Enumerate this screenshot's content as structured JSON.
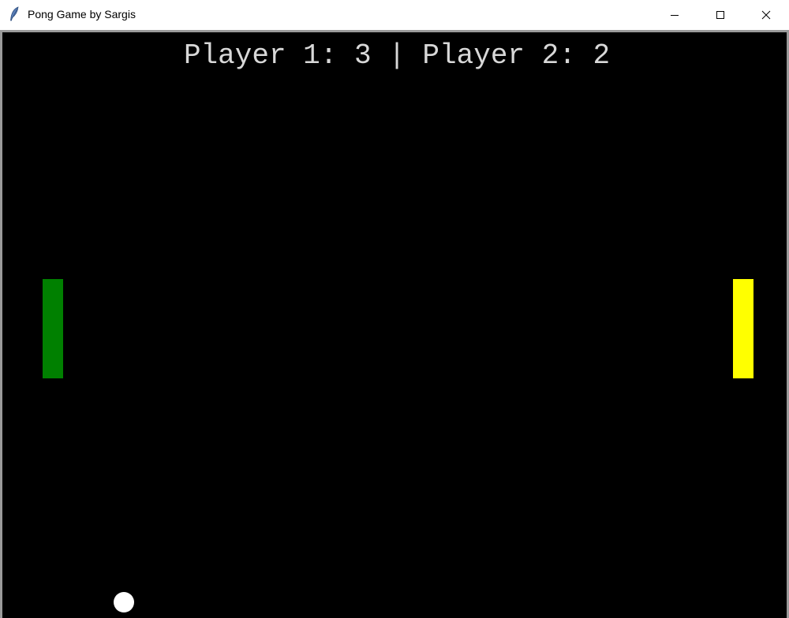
{
  "window": {
    "title": "Pong Game by Sargis",
    "icon": "feather-icon",
    "controls": {
      "minimize": "minimize-icon",
      "maximize": "maximize-icon",
      "close": "close-icon"
    }
  },
  "game": {
    "scoreboard": {
      "text": "Player 1: 3 | Player 2: 2",
      "player1_label": "Player 1",
      "player1_score": 3,
      "player2_label": "Player 2",
      "player2_score": 2
    },
    "colors": {
      "background": "#000000",
      "score_text": "#d8d8d8",
      "paddle_left": "#008000",
      "paddle_right": "#ffff00",
      "ball": "#ffffff"
    }
  }
}
